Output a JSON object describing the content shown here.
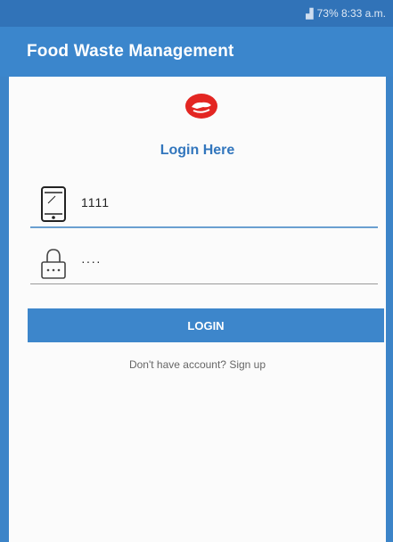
{
  "status_bar": {
    "text": "73% 8:33 a.m."
  },
  "app_bar": {
    "title": "Food Waste Management"
  },
  "login": {
    "title": "Login Here",
    "phone_value": "1111",
    "password_value": "····",
    "button_label": "LOGIN",
    "signup_text": "Don't have account? Sign up"
  },
  "colors": {
    "primary": "#3b86cc",
    "primary_dark": "#3173b8",
    "logo_red": "#e32622"
  }
}
